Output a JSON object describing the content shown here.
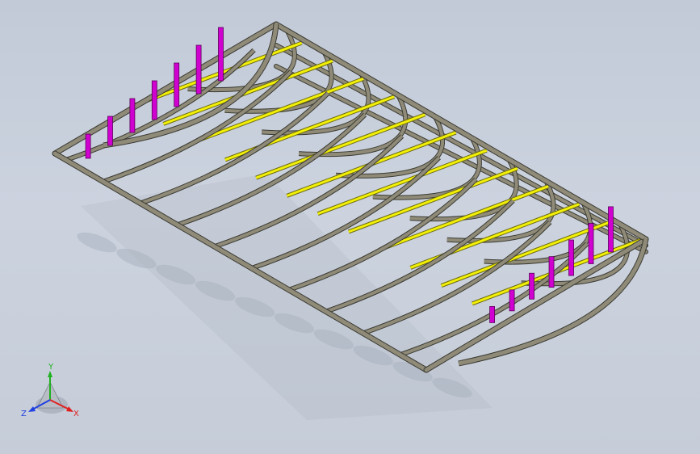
{
  "colors": {
    "background_top": "#c2cad8",
    "background_bottom": "#c6cdd9",
    "frame": "#8f8b78",
    "frame_edge": "#3a3a32",
    "slat": "#f2ef08",
    "slat_edge": "#6b6a10",
    "post": "#d000d0",
    "post_edge": "#5a005a",
    "shadow": "#aab2c0",
    "axis_x": "#e02020",
    "axis_y": "#20b020",
    "axis_z": "#2040e0"
  },
  "triad": {
    "x_label": "X",
    "y_label": "Y",
    "z_label": "Z"
  },
  "model": {
    "rib_count": 10,
    "slat_count": 12,
    "post_count": 7
  }
}
